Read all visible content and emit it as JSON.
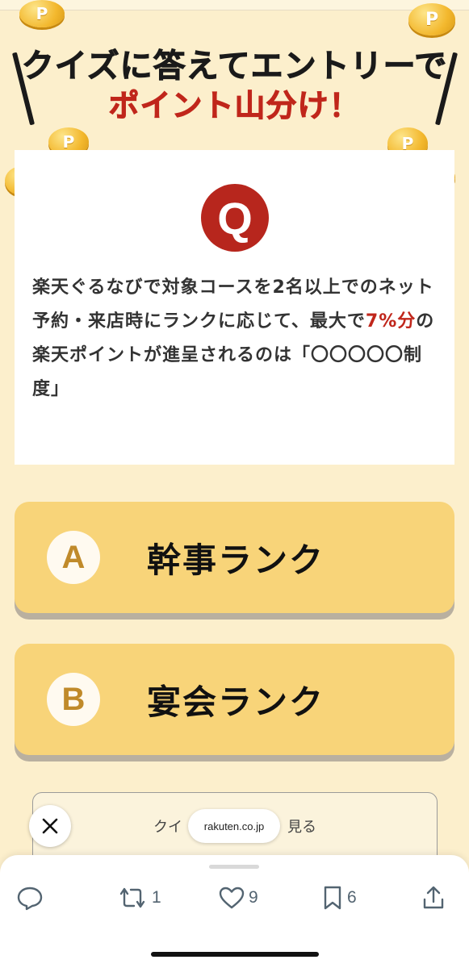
{
  "banner": {
    "title_line1": "クイズに答えてエントリーで",
    "title_line2": "ポイント山分け！",
    "coin_letter": "P"
  },
  "question": {
    "badge": "Q",
    "text_before": "楽天ぐるなびで対象コースを2名以上でのネット予約・来店時にランクに応じて、最大で",
    "text_highlight": "7%分",
    "text_after": "の楽天ポイントが進呈されるのは「〇〇〇〇〇制度」"
  },
  "answers": [
    {
      "letter": "A",
      "label": "幹事ランク"
    },
    {
      "letter": "B",
      "label": "宴会ランク"
    }
  ],
  "more_card": {
    "text_left": "クイ",
    "text_right": "見る"
  },
  "link_pill": {
    "domain": "rakuten.co.jp"
  },
  "actions": {
    "retweet_count": "1",
    "like_count": "9",
    "bookmark_count": "6"
  },
  "colors": {
    "background": "#fcefcc",
    "accent_red": "#c0261b",
    "answer_fill": "#f8d479",
    "coin_gold": "#f3b82e"
  }
}
